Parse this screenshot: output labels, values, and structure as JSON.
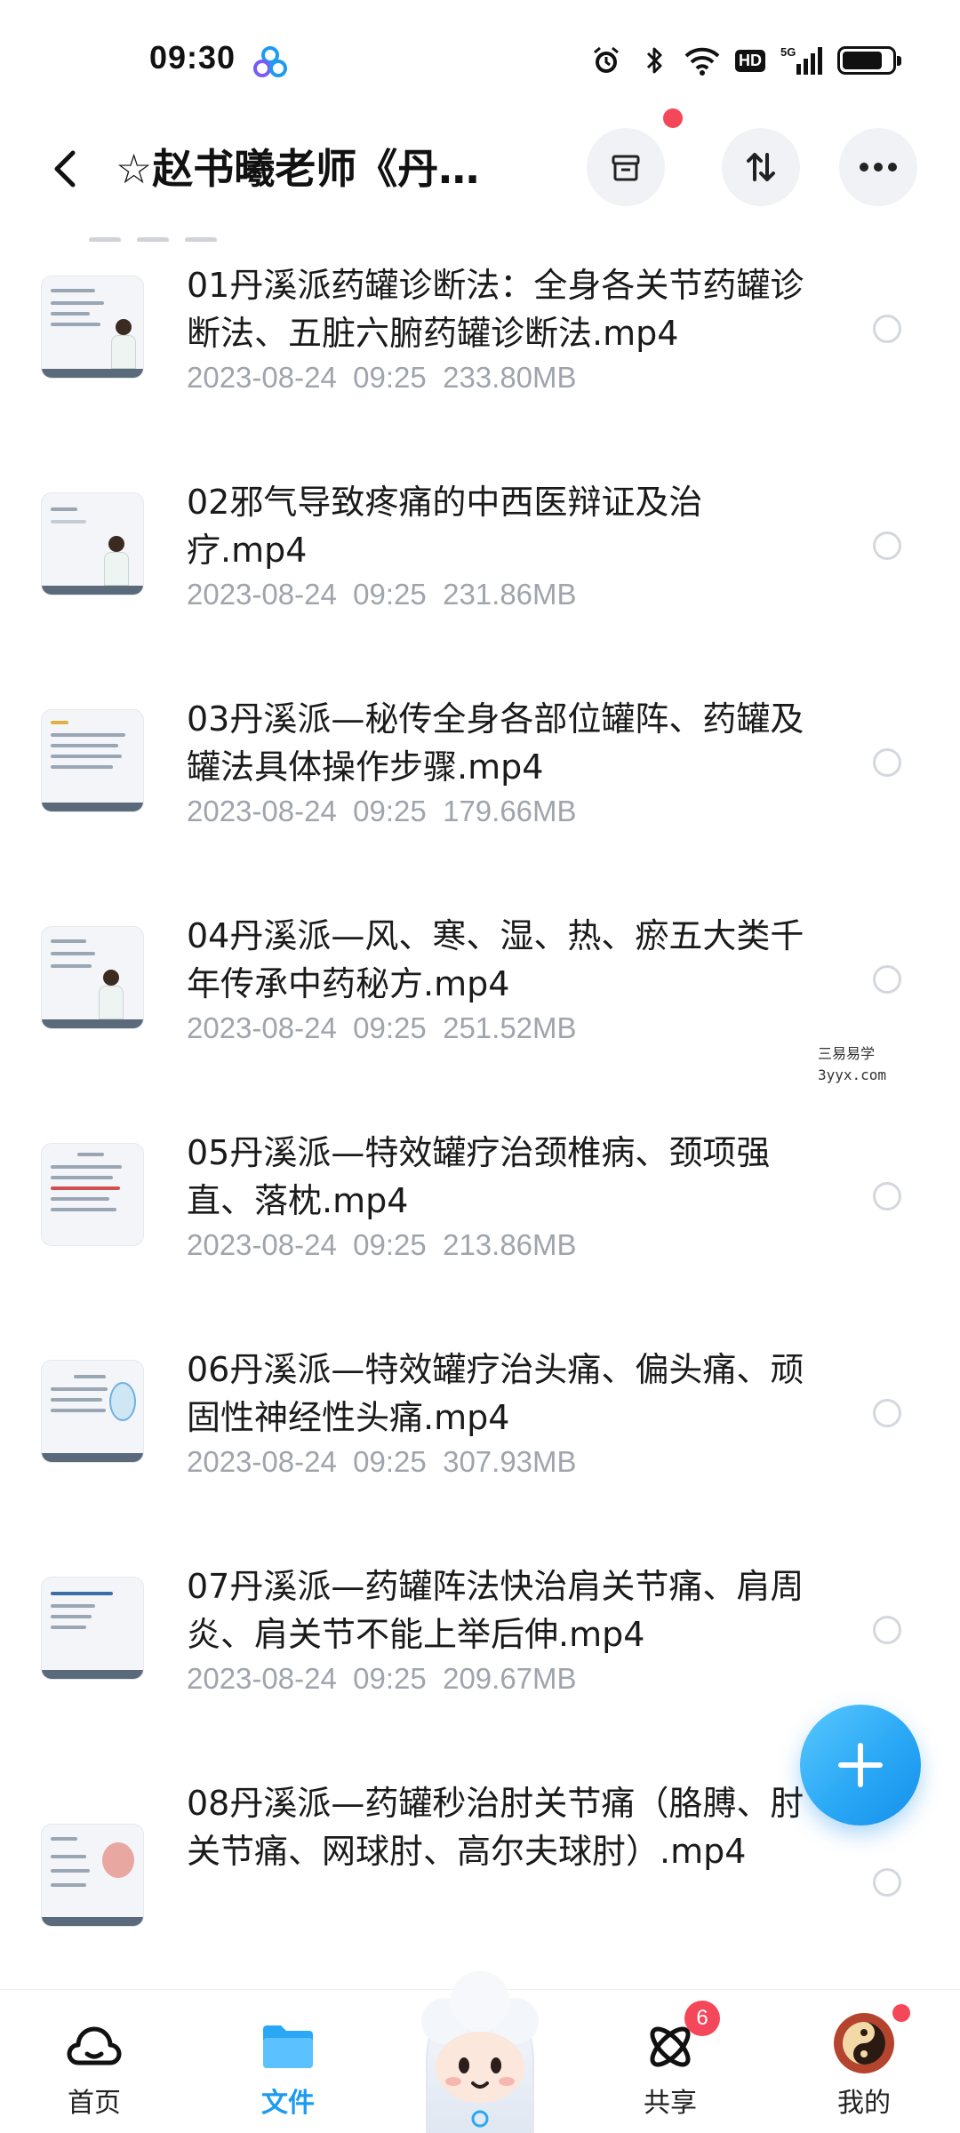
{
  "status_bar": {
    "time": "09:30",
    "network": "5G",
    "hd_label": "HD",
    "icons": [
      "app-cloud-icon",
      "alarm-icon",
      "bluetooth-icon",
      "wifi-icon",
      "hd-icon",
      "signal-icon",
      "battery-icon"
    ]
  },
  "header": {
    "title": "☆赵书曦老师《丹溪派药罐》",
    "actions": [
      "archive-icon",
      "sort-icon",
      "more-icon"
    ]
  },
  "files": [
    {
      "name": "01丹溪派药罐诊断法：全身各关节药罐诊断法、五脏六腑药罐诊断法.mp4",
      "date": "2023-08-24",
      "time": "09:25",
      "size": "233.80MB"
    },
    {
      "name": "02邪气导致疼痛的中西医辩证及治疗.mp4",
      "date": "2023-08-24",
      "time": "09:25",
      "size": "231.86MB"
    },
    {
      "name": "03丹溪派—秘传全身各部位罐阵、药罐及罐法具体操作步骤.mp4",
      "date": "2023-08-24",
      "time": "09:25",
      "size": "179.66MB"
    },
    {
      "name": "04丹溪派—风、寒、湿、热、瘀五大类千年传承中药秘方.mp4",
      "date": "2023-08-24",
      "time": "09:25",
      "size": "251.52MB"
    },
    {
      "name": "05丹溪派—特效罐疗治颈椎病、颈项强直、落枕.mp4",
      "date": "2023-08-24",
      "time": "09:25",
      "size": "213.86MB"
    },
    {
      "name": "06丹溪派—特效罐疗治头痛、偏头痛、顽固性神经性头痛.mp4",
      "date": "2023-08-24",
      "time": "09:25",
      "size": "307.93MB"
    },
    {
      "name": "07丹溪派—药罐阵法快治肩关节痛、肩周炎、肩关节不能上举后伸.mp4",
      "date": "2023-08-24",
      "time": "09:25",
      "size": "209.67MB"
    },
    {
      "name": "08丹溪派—药罐秒治肘关节痛（胳膊、肘关节痛、网球肘、高尔夫球肘）.mp4",
      "date": "",
      "time": "",
      "size": ""
    }
  ],
  "watermark": {
    "line1": "三易易学",
    "line2": "3yyx.com"
  },
  "fab": {
    "icon": "plus-icon"
  },
  "bottom_nav": {
    "items": [
      {
        "label": "首页",
        "icon": "home-cloud-icon",
        "active": false
      },
      {
        "label": "文件",
        "icon": "folder-icon",
        "active": true
      },
      {
        "label": "共享",
        "icon": "share-atom-icon",
        "active": false,
        "badge": "6"
      },
      {
        "label": "我的",
        "icon": "profile-avatar-icon",
        "active": false
      }
    ]
  },
  "colors": {
    "accent": "#1d9bf0",
    "meta_text": "#9fa4ad",
    "badge": "#f4485a",
    "fab": "#2aa8f5"
  }
}
